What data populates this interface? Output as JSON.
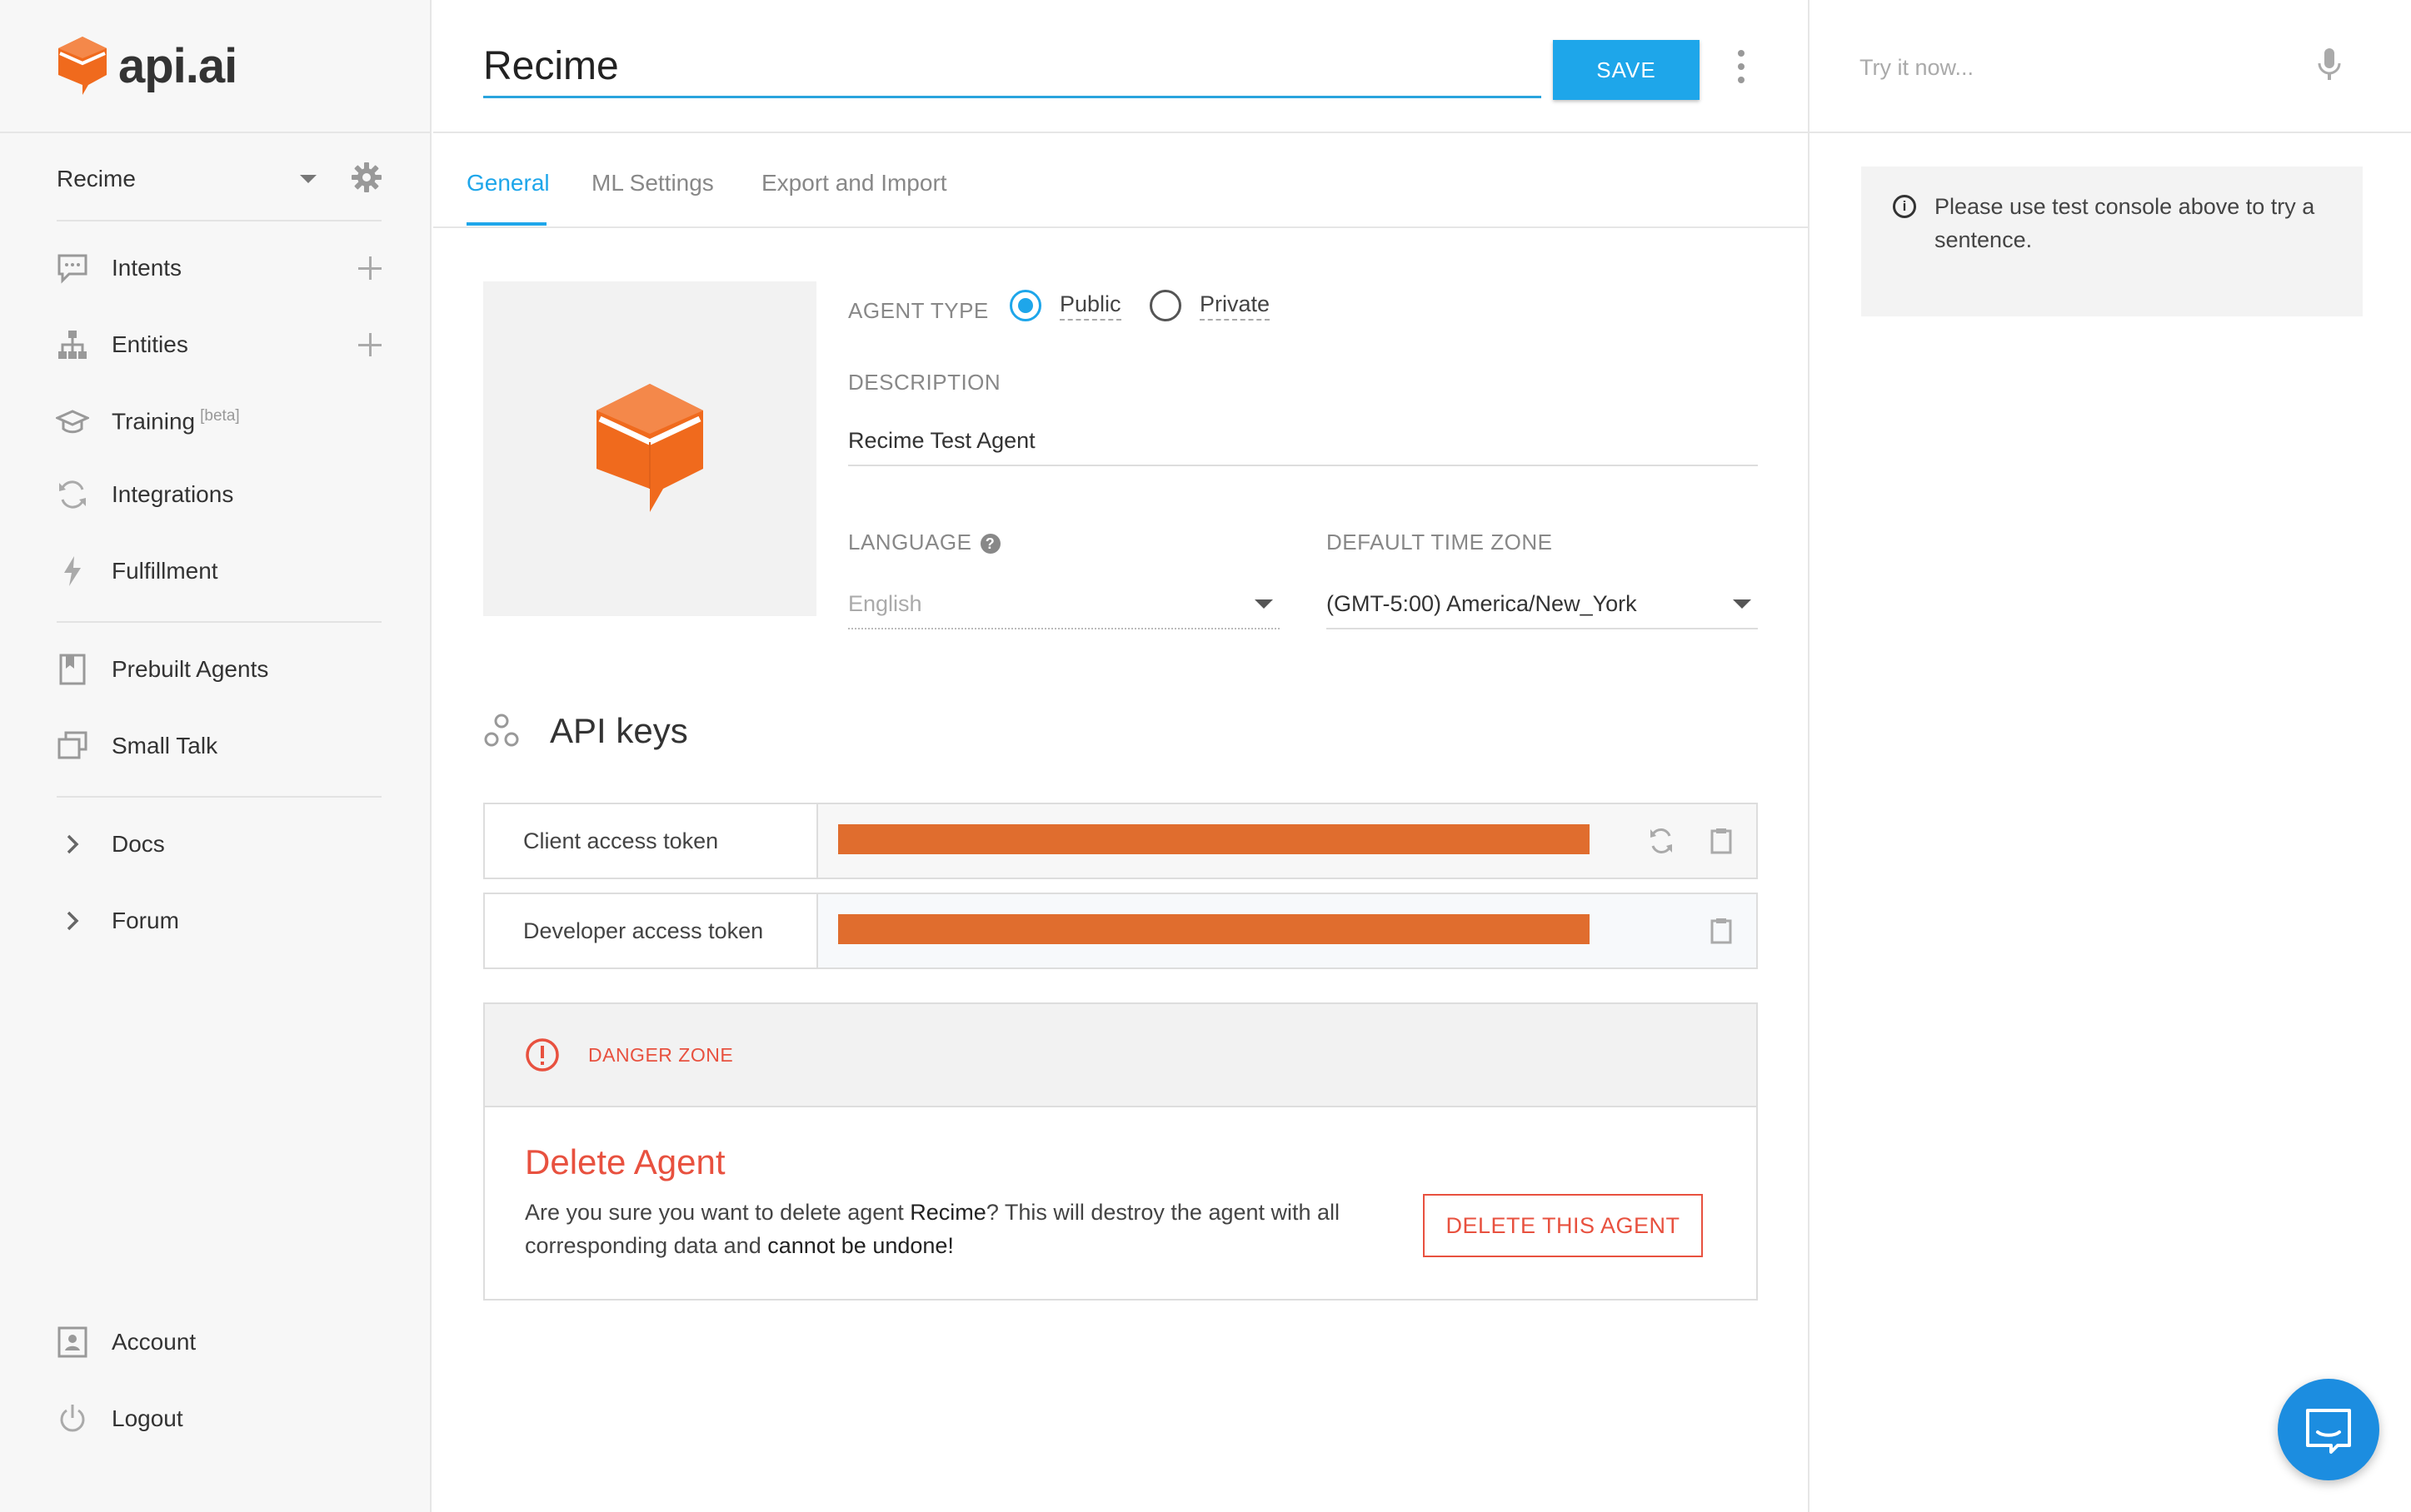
{
  "brand": {
    "name": "api.ai",
    "accent": "#f06a1d",
    "primary": "#1ea6ea",
    "danger": "#e8513f"
  },
  "sidebar": {
    "agent_name": "Recime",
    "nav": [
      {
        "id": "intents",
        "label": "Intents",
        "icon": "chat-bubble-icon",
        "addable": true
      },
      {
        "id": "entities",
        "label": "Entities",
        "icon": "hierarchy-icon",
        "addable": true
      },
      {
        "id": "training",
        "label": "Training",
        "sup": "[beta]",
        "icon": "graduation-cap-icon"
      },
      {
        "id": "integrations",
        "label": "Integrations",
        "icon": "sync-icon"
      },
      {
        "id": "fulfillment",
        "label": "Fulfillment",
        "icon": "lightning-icon"
      },
      {
        "id": "prebuilt",
        "label": "Prebuilt Agents",
        "icon": "book-icon"
      },
      {
        "id": "smalltalk",
        "label": "Small Talk",
        "icon": "chat-window-icon"
      },
      {
        "id": "docs",
        "label": "Docs",
        "icon": "chevron-right-icon"
      },
      {
        "id": "forum",
        "label": "Forum",
        "icon": "chevron-right-icon"
      },
      {
        "id": "account",
        "label": "Account",
        "icon": "user-card-icon"
      },
      {
        "id": "logout",
        "label": "Logout",
        "icon": "power-icon"
      }
    ]
  },
  "header": {
    "agent_name_value": "Recime",
    "save_label": "SAVE"
  },
  "tabs": [
    {
      "label": "General",
      "active": true
    },
    {
      "label": "ML Settings",
      "active": false
    },
    {
      "label": "Export and Import",
      "active": false
    }
  ],
  "general": {
    "agent_type_label": "AGENT TYPE",
    "agent_type_options": [
      {
        "label": "Public",
        "selected": true
      },
      {
        "label": "Private",
        "selected": false
      }
    ],
    "description_label": "DESCRIPTION",
    "description_value": "Recime Test Agent",
    "language_label": "LANGUAGE",
    "language_value": "English",
    "timezone_label": "DEFAULT TIME ZONE",
    "timezone_value": "(GMT-5:00) America/New_York"
  },
  "api_keys": {
    "title": "API keys",
    "rows": [
      {
        "label": "Client access token",
        "refresh": true
      },
      {
        "label": "Developer access token",
        "refresh": false
      }
    ]
  },
  "danger_zone": {
    "label": "DANGER ZONE",
    "title": "Delete Agent",
    "text_1": "Are you sure you want to delete agent ",
    "text_agent": "Recime",
    "text_2": "? This will destroy the agent with all corresponding data and ",
    "text_bold": "cannot be undone!",
    "button_label": "DELETE THIS AGENT"
  },
  "console": {
    "placeholder": "Try it now...",
    "hint": "Please use test console above to try a sentence."
  }
}
